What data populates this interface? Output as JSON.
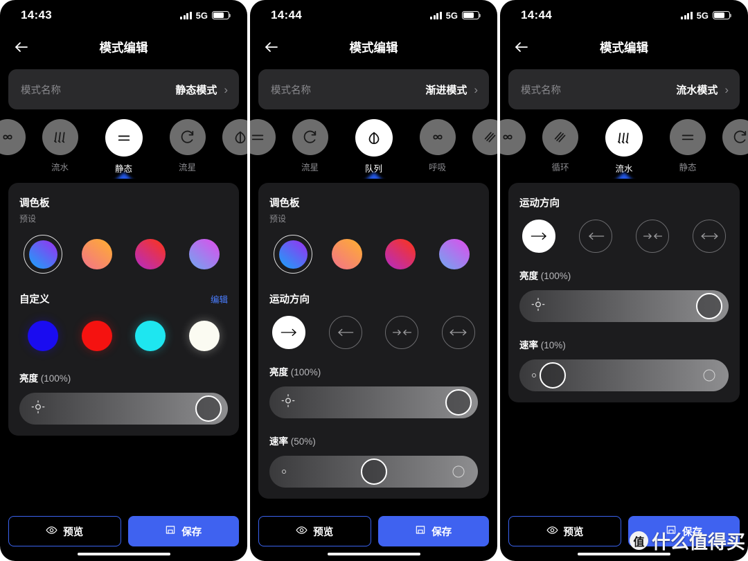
{
  "app": {
    "nav_title": "模式编辑",
    "back_icon": "back-arrow-icon",
    "chevron": "›"
  },
  "panels": [
    {
      "id": "panel-static",
      "statusbar": {
        "time": "14:43",
        "network": "5G",
        "signal_icon": "signal-bars-icon",
        "battery_icon": "battery-icon"
      },
      "mode_name": {
        "label": "模式名称",
        "value": "静态模式"
      },
      "carousel": {
        "modes": [
          {
            "name": "",
            "icon": "breathing-icon",
            "selected": false,
            "partial": true
          },
          {
            "name": "流水",
            "icon": "flowing-water-icon",
            "selected": false,
            "partial": false
          },
          {
            "name": "静态",
            "icon": "static-icon",
            "selected": true,
            "partial": false
          },
          {
            "name": "流星",
            "icon": "meteor-icon",
            "selected": false,
            "partial": false
          },
          {
            "name": "",
            "icon": "queue-icon",
            "selected": false,
            "partial": true
          }
        ]
      },
      "sections": [
        {
          "kind": "palette",
          "title": "调色板",
          "subtitle": "预设",
          "presets": [
            {
              "name": "blue-purple-gradient",
              "from": "#18a4f8",
              "to": "#9b2ff0",
              "selected": true
            },
            {
              "name": "orange-pink-gradient",
              "from": "#f2728c",
              "to": "#ffb02e",
              "selected": false
            },
            {
              "name": "red-magenta-gradient",
              "from": "#b32bc8",
              "to": "#ff3514",
              "selected": false
            },
            {
              "name": "purple-blue-gradient",
              "from": "#6fa8f0",
              "to": "#e04ceb",
              "selected": false
            }
          ]
        },
        {
          "kind": "custom",
          "title": "自定义",
          "edit_label": "编辑",
          "colors": [
            {
              "name": "blue",
              "hex": "#1a0cf0"
            },
            {
              "name": "red",
              "hex": "#f51210"
            },
            {
              "name": "cyan",
              "hex": "#1ee6f0"
            },
            {
              "name": "white",
              "hex": "#fbfbf2"
            }
          ]
        },
        {
          "kind": "slider",
          "name": "brightness",
          "label": "亮度",
          "value_text": "(100%)",
          "percent": 100,
          "left_icon": "brightness-icon",
          "has_ghost_knob": false
        }
      ],
      "buttons": {
        "preview": "预览",
        "save": "保存",
        "preview_icon": "eye-icon",
        "save_icon": "save-icon"
      },
      "watermark": null
    },
    {
      "id": "panel-gradual",
      "statusbar": {
        "time": "14:44",
        "network": "5G",
        "signal_icon": "signal-bars-icon",
        "battery_icon": "battery-icon"
      },
      "mode_name": {
        "label": "模式名称",
        "value": "渐进模式"
      },
      "carousel": {
        "modes": [
          {
            "name": "",
            "icon": "static-icon",
            "selected": false,
            "partial": true
          },
          {
            "name": "流星",
            "icon": "meteor-icon",
            "selected": false,
            "partial": false
          },
          {
            "name": "队列",
            "icon": "queue-icon",
            "selected": true,
            "partial": false
          },
          {
            "name": "呼吸",
            "icon": "breathing-icon",
            "selected": false,
            "partial": false
          },
          {
            "name": "",
            "icon": "cycle-icon",
            "selected": false,
            "partial": true
          }
        ]
      },
      "sections": [
        {
          "kind": "palette",
          "title": "调色板",
          "subtitle": "预设",
          "presets": [
            {
              "name": "blue-purple-gradient",
              "from": "#18a4f8",
              "to": "#9b2ff0",
              "selected": true
            },
            {
              "name": "orange-pink-gradient",
              "from": "#f2728c",
              "to": "#ffb02e",
              "selected": false
            },
            {
              "name": "red-magenta-gradient",
              "from": "#b32bc8",
              "to": "#ff3514",
              "selected": false
            },
            {
              "name": "purple-blue-gradient",
              "from": "#6fa8f0",
              "to": "#e04ceb",
              "selected": false
            }
          ]
        },
        {
          "kind": "direction",
          "title": "运动方向",
          "options": [
            {
              "name": "right-arrow",
              "glyph": "⟶",
              "selected": true
            },
            {
              "name": "left-arrow",
              "glyph": "⟵",
              "selected": false
            },
            {
              "name": "converge-arrows",
              "glyph": "➔➔",
              "selected": false
            },
            {
              "name": "bidirectional-arrow",
              "glyph": "⟷",
              "selected": false
            }
          ]
        },
        {
          "kind": "slider",
          "name": "brightness",
          "label": "亮度",
          "value_text": "(100%)",
          "percent": 100,
          "left_icon": "brightness-icon",
          "has_ghost_knob": false
        },
        {
          "kind": "slider",
          "name": "speed",
          "label": "速率",
          "value_text": "(50%)",
          "percent": 50,
          "left_icon": "small-circle-icon",
          "has_ghost_knob": true
        }
      ],
      "buttons": {
        "preview": "预览",
        "save": "保存",
        "preview_icon": "eye-icon",
        "save_icon": "save-icon"
      },
      "watermark": null
    },
    {
      "id": "panel-flowing",
      "statusbar": {
        "time": "14:44",
        "network": "5G",
        "signal_icon": "signal-bars-icon",
        "battery_icon": "battery-icon"
      },
      "mode_name": {
        "label": "模式名称",
        "value": "流水模式"
      },
      "carousel": {
        "modes": [
          {
            "name": "",
            "icon": "breathing-icon",
            "selected": false,
            "partial": true
          },
          {
            "name": "循环",
            "icon": "cycle-icon",
            "selected": false,
            "partial": false
          },
          {
            "name": "流水",
            "icon": "flowing-water-icon",
            "selected": true,
            "partial": false
          },
          {
            "name": "静态",
            "icon": "static-icon",
            "selected": false,
            "partial": false
          },
          {
            "name": "",
            "icon": "meteor-icon",
            "selected": false,
            "partial": true
          }
        ]
      },
      "sections": [
        {
          "kind": "direction",
          "title": "运动方向",
          "options": [
            {
              "name": "right-arrow",
              "glyph": "⟶",
              "selected": true
            },
            {
              "name": "left-arrow",
              "glyph": "⟵",
              "selected": false
            },
            {
              "name": "converge-arrows",
              "glyph": "➔➔",
              "selected": false
            },
            {
              "name": "bidirectional-arrow",
              "glyph": "⟷",
              "selected": false
            }
          ]
        },
        {
          "kind": "slider",
          "name": "brightness",
          "label": "亮度",
          "value_text": "(100%)",
          "percent": 100,
          "left_icon": "brightness-icon",
          "has_ghost_knob": false
        },
        {
          "kind": "slider",
          "name": "speed",
          "label": "速率",
          "value_text": "(10%)",
          "percent": 10,
          "left_icon": "small-circle-icon",
          "has_ghost_knob": true
        }
      ],
      "buttons": {
        "preview": "预览",
        "save": "保存",
        "preview_icon": "eye-icon",
        "save_icon": "save-icon"
      },
      "watermark": {
        "badge": "值",
        "text": "什么值得买"
      }
    }
  ]
}
